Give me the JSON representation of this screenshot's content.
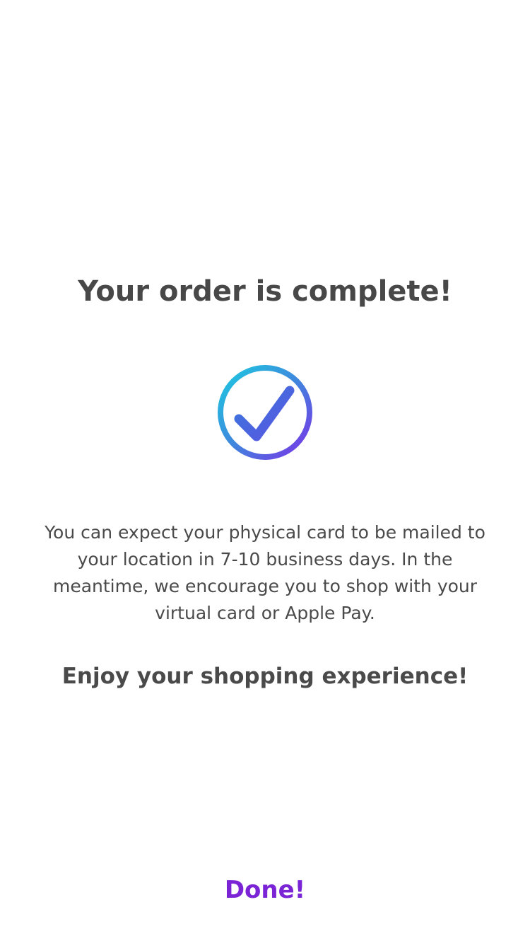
{
  "confirmation": {
    "title": "Your order is complete!",
    "icon": "check-circle-icon",
    "message": "You can expect your physical card to be mailed to your location in 7-10 business days. In the meantime, we encourage you to shop with your virtual card or Apple Pay.",
    "closing": "Enjoy your shopping experience!",
    "done_label": "Done!"
  },
  "colors": {
    "text": "#4a4a4a",
    "accent": "#7a24d6",
    "icon_gradient_start": "#1fc8e0",
    "icon_gradient_end": "#7a35e8"
  }
}
